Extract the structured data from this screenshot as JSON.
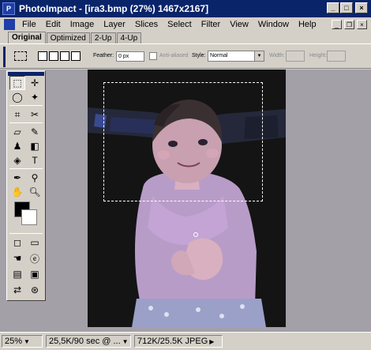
{
  "window": {
    "title": "PhotoImpact - [ira3.bmp (27%) 1467x2167]",
    "app_icon_letter": "P",
    "minimize": "_",
    "maximize": "□",
    "close": "×"
  },
  "menu": {
    "items": [
      "File",
      "Edit",
      "Image",
      "Layer",
      "Slices",
      "Select",
      "Filter",
      "View",
      "Window",
      "Help"
    ],
    "doc_minimize": "_",
    "doc_restore": "❐",
    "doc_close": "×"
  },
  "tabs": [
    "Original",
    "Optimized",
    "2-Up",
    "4-Up"
  ],
  "options": {
    "feather_label": "Feather:",
    "feather_value": "0 px",
    "antialiased_label": "Anti-aliased",
    "style_label": "Style:",
    "style_value": "Normal",
    "width_label": "Width:",
    "height_label": "Height:"
  },
  "status": {
    "zoom": "25%",
    "download_time": "25,5K/90 sec @ ...",
    "file_size": "712K/25.5K JPEG"
  },
  "colors": {
    "title_bg": "#0a246a",
    "chrome": "#d4d0c8",
    "workspace": "#a4a0a8",
    "canvas": "#141414"
  }
}
